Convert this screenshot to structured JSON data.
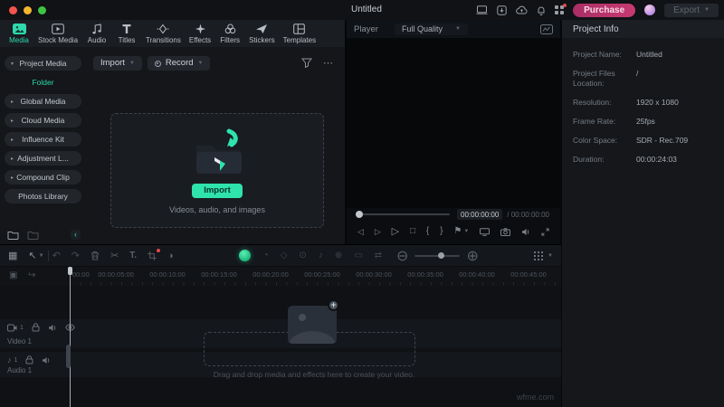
{
  "window": {
    "title": "Untitled"
  },
  "topbar": {
    "purchase_label": "Purchase",
    "export_label": "Export"
  },
  "tabs": [
    {
      "label": "Media"
    },
    {
      "label": "Stock Media"
    },
    {
      "label": "Audio"
    },
    {
      "label": "Titles"
    },
    {
      "label": "Transitions"
    },
    {
      "label": "Effects"
    },
    {
      "label": "Filters"
    },
    {
      "label": "Stickers"
    },
    {
      "label": "Templates"
    }
  ],
  "sidebar": {
    "items": [
      {
        "label": "Project Media"
      },
      {
        "label": "Folder"
      },
      {
        "label": "Global Media"
      },
      {
        "label": "Cloud Media"
      },
      {
        "label": "Influence Kit"
      },
      {
        "label": "Adjustment L..."
      },
      {
        "label": "Compound Clip"
      },
      {
        "label": "Photos Library"
      }
    ]
  },
  "media_toolbar": {
    "import_label": "Import",
    "record_label": "Record"
  },
  "dropzone": {
    "button_label": "Import",
    "caption": "Videos, audio, and images"
  },
  "player": {
    "title": "Player",
    "quality": "Full Quality",
    "current_time": "00:00:00:00",
    "total_time": "/  00:00:00:00"
  },
  "project_info": {
    "title": "Project Info",
    "rows": [
      {
        "label": "Project Name:",
        "value": "Untitled"
      },
      {
        "label": "Project Files Location:",
        "value": "/"
      },
      {
        "label": "Resolution:",
        "value": "1920 x 1080"
      },
      {
        "label": "Frame Rate:",
        "value": "25fps"
      },
      {
        "label": "Color Space:",
        "value": "SDR - Rec.709"
      },
      {
        "label": "Duration:",
        "value": "00:00:24:03"
      }
    ]
  },
  "timeline": {
    "ruler_labels": [
      "00:00",
      "00:00:05:00",
      "00:00:10:00",
      "00:00:15:00",
      "00:00:20:00",
      "00:00:25:00",
      "00:00:30:00",
      "00:00:35:00",
      "00:00:40:00",
      "00:00:45:00"
    ],
    "tracks": [
      {
        "name": "Video 1",
        "number": "1"
      },
      {
        "name": "Audio 1",
        "number": "1"
      }
    ],
    "dropzone_text": "Drag and drop media and effects here to create your video."
  },
  "watermark": "wfme.com",
  "colors": {
    "accent_teal": "#2fd9ac",
    "purchase_pink": "#b23071",
    "ai_green": "#35e08e"
  }
}
